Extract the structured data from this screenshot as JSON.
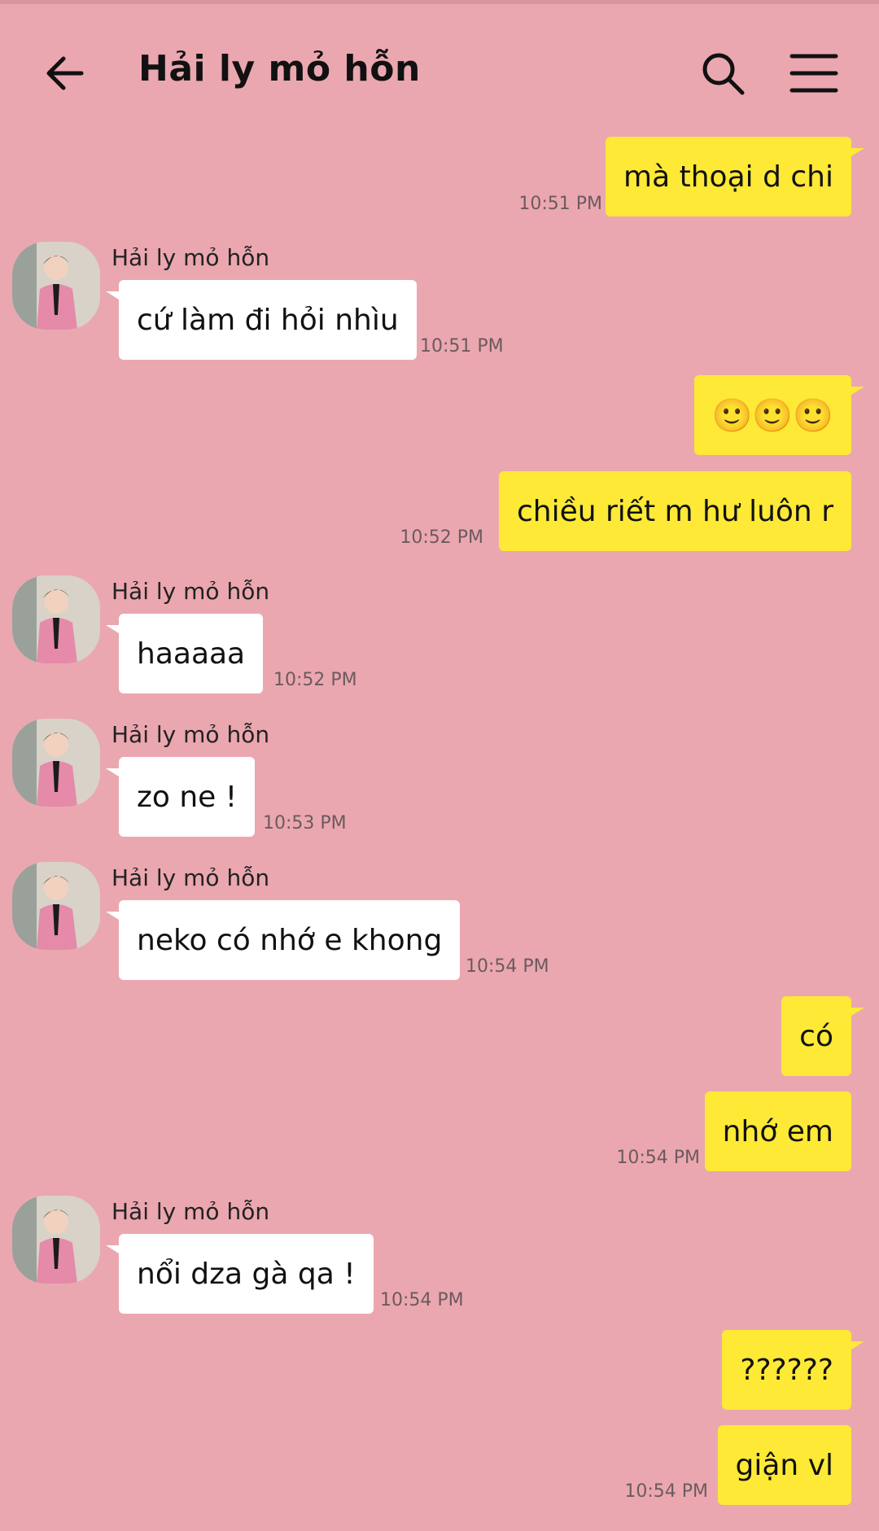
{
  "header": {
    "title": "Hải ly mỏ hỗn",
    "icons": {
      "back": "arrow-left-icon",
      "search": "search-icon",
      "menu": "hamburger-menu-icon"
    }
  },
  "colors": {
    "background": "#eba7b0",
    "outgoing_bubble": "#fde936",
    "incoming_bubble": "#ffffff"
  },
  "messages": [
    {
      "direction": "out",
      "text": "mà thoại d chi",
      "time": "10:51 PM"
    },
    {
      "direction": "in",
      "sender": "Hải ly mỏ hỗn",
      "text": "cứ làm đi hỏi nhìu",
      "time": "10:51 PM"
    },
    {
      "direction": "out",
      "text": "🙂🙂🙂",
      "time": ""
    },
    {
      "direction": "out",
      "text": "chiều riết m hư luôn r",
      "time": "10:52 PM"
    },
    {
      "direction": "in",
      "sender": "Hải ly mỏ hỗn",
      "text": "haaaaa",
      "time": "10:52 PM"
    },
    {
      "direction": "in",
      "sender": "Hải ly mỏ hỗn",
      "text": "zo ne !",
      "time": "10:53 PM"
    },
    {
      "direction": "in",
      "sender": "Hải ly mỏ hỗn",
      "text": "neko có nhớ e khong",
      "time": "10:54 PM"
    },
    {
      "direction": "out",
      "text": "có",
      "time": ""
    },
    {
      "direction": "out",
      "text": "nhớ em",
      "time": "10:54 PM"
    },
    {
      "direction": "in",
      "sender": "Hải ly mỏ hỗn",
      "text": "nổi dza gà qa !",
      "time": "10:54 PM"
    },
    {
      "direction": "out",
      "text": "??????",
      "time": ""
    },
    {
      "direction": "out",
      "text": "giận vl",
      "time": "10:54 PM"
    }
  ]
}
